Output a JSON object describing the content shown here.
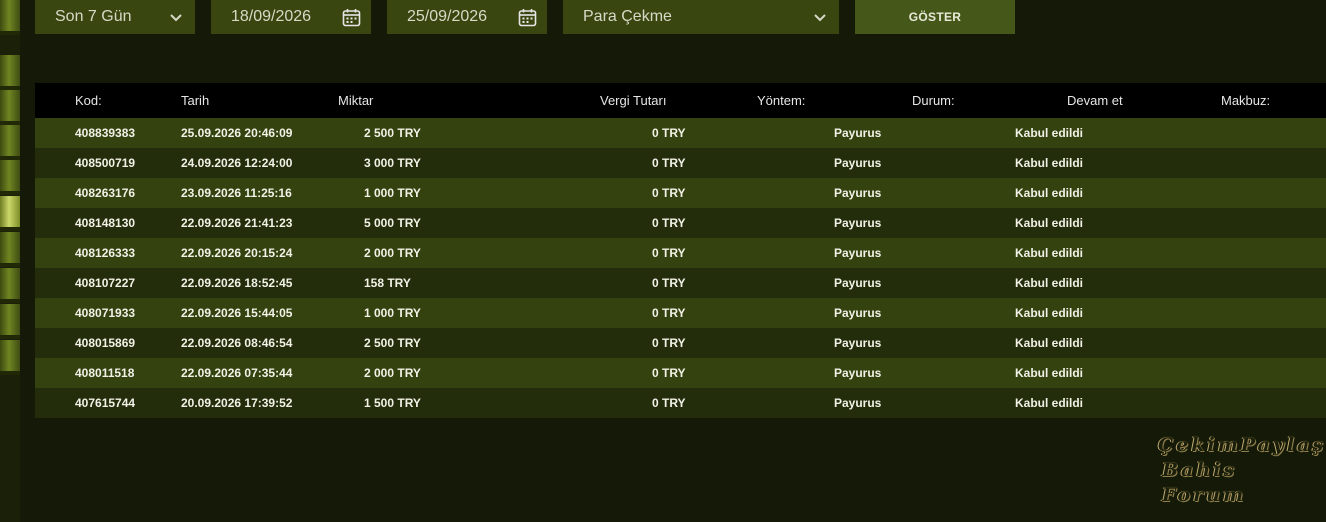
{
  "filters": {
    "period": "Son 7 Gün",
    "date_from": "18/09/2026",
    "date_to": "25/09/2026",
    "type": "Para Çekme",
    "show_label": "GÖSTER"
  },
  "table": {
    "headers": {
      "code": "Kod:",
      "date": "Tarih",
      "amount": "Miktar",
      "tax": "Vergi Tutarı",
      "method": "Yöntem:",
      "status": "Durum:",
      "continue": "Devam et",
      "receipt": "Makbuz:"
    },
    "rows": [
      {
        "code": "408839383",
        "date": "25.09.2026 20:46:09",
        "amount": "2 500 TRY",
        "tax": "0 TRY",
        "method": "Payurus",
        "status": "Kabul edildi"
      },
      {
        "code": "408500719",
        "date": "24.09.2026 12:24:00",
        "amount": "3 000 TRY",
        "tax": "0 TRY",
        "method": "Payurus",
        "status": "Kabul edildi"
      },
      {
        "code": "408263176",
        "date": "23.09.2026 11:25:16",
        "amount": "1 000 TRY",
        "tax": "0 TRY",
        "method": "Payurus",
        "status": "Kabul edildi"
      },
      {
        "code": "408148130",
        "date": "22.09.2026 21:41:23",
        "amount": "5 000 TRY",
        "tax": "0 TRY",
        "method": "Payurus",
        "status": "Kabul edildi"
      },
      {
        "code": "408126333",
        "date": "22.09.2026 20:15:24",
        "amount": "2 000 TRY",
        "tax": "0 TRY",
        "method": "Payurus",
        "status": "Kabul edildi"
      },
      {
        "code": "408107227",
        "date": "22.09.2026 18:52:45",
        "amount": "158 TRY",
        "tax": "0 TRY",
        "method": "Payurus",
        "status": "Kabul edildi"
      },
      {
        "code": "408071933",
        "date": "22.09.2026 15:44:05",
        "amount": "1 000 TRY",
        "tax": "0 TRY",
        "method": "Payurus",
        "status": "Kabul edildi"
      },
      {
        "code": "408015869",
        "date": "22.09.2026 08:46:54",
        "amount": "2 500 TRY",
        "tax": "0 TRY",
        "method": "Payurus",
        "status": "Kabul edildi"
      },
      {
        "code": "408011518",
        "date": "22.09.2026 07:35:44",
        "amount": "2 000 TRY",
        "tax": "0 TRY",
        "method": "Payurus",
        "status": "Kabul edildi"
      },
      {
        "code": "407615744",
        "date": "20.09.2026 17:39:52",
        "amount": "1 500 TRY",
        "tax": "0 TRY",
        "method": "Payurus",
        "status": "Kabul edildi"
      }
    ]
  },
  "watermark": {
    "line1": "ÇekimPaylaş",
    "line2": "Bahis Forum"
  },
  "icons": {
    "select_arrow": "chevron-down-icon",
    "date_picker": "calendar-icon"
  },
  "colors": {
    "background": "#141a07",
    "control": "#3a4610",
    "button": "#46571a",
    "row_odd": "#344210",
    "row_even": "#232d0b",
    "header": "#000000"
  }
}
